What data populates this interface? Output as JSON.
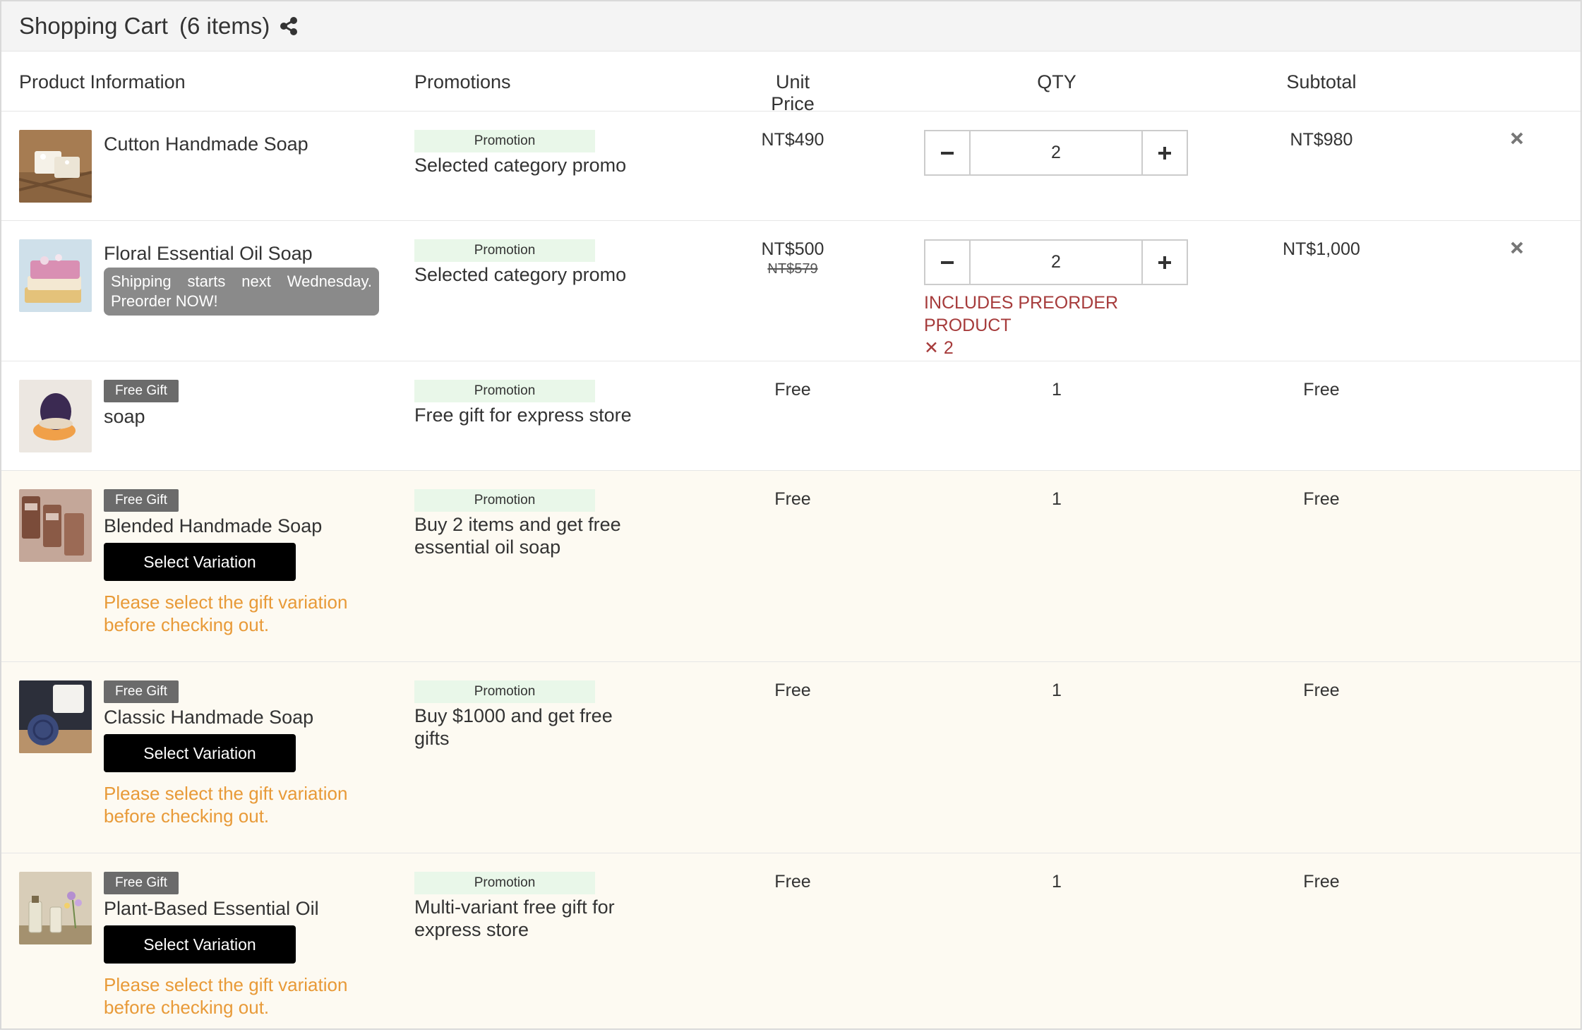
{
  "header": {
    "title": "Shopping Cart",
    "count": "(6 items)"
  },
  "columns": {
    "product": "Product Information",
    "promotions": "Promotions",
    "unit_price": "Unit Price",
    "qty": "QTY",
    "subtotal": "Subtotal"
  },
  "items": [
    {
      "name": "Cutton Handmade Soap",
      "promo_tag": "Promotion",
      "promo_text": "Selected category promo",
      "price": "NT$490",
      "qty": "2",
      "subtotal": "NT$980"
    },
    {
      "name": "Floral Essential Oil Soap",
      "note": "Shipping starts next Wednesday. Preorder NOW!",
      "promo_tag": "Promotion",
      "promo_text": "Selected category promo",
      "price": "NT$500",
      "orig_price": "NT$579",
      "qty": "2",
      "warning_line1": "INCLUDES PREORDER PRODUCT",
      "warning_line2": "✕ 2",
      "subtotal": "NT$1,000"
    },
    {
      "tag": "Free Gift",
      "name": "soap",
      "promo_tag": "Promotion",
      "promo_text": "Free gift for express store",
      "price": "Free",
      "qty": "1",
      "subtotal": "Free"
    },
    {
      "tag": "Free Gift",
      "name": "Blended Handmade Soap",
      "button": "Select Variation",
      "warning": "Please select the gift variation before checking out.",
      "promo_tag": "Promotion",
      "promo_text": "Buy 2 items and get free essential oil soap",
      "price": "Free",
      "qty": "1",
      "subtotal": "Free"
    },
    {
      "tag": "Free Gift",
      "name": "Classic Handmade Soap",
      "button": "Select Variation",
      "warning": "Please select the gift variation before checking out.",
      "promo_tag": "Promotion",
      "promo_text": "Buy $1000 and get free gifts",
      "price": "Free",
      "qty": "1",
      "subtotal": "Free"
    },
    {
      "tag": "Free Gift",
      "name": "Plant-Based Essential Oil",
      "button": "Select Variation",
      "warning": "Please select the gift variation before checking out.",
      "promo_tag": "Promotion",
      "promo_text": "Multi-variant free gift for express store",
      "price": "Free",
      "qty": "1",
      "subtotal": "Free"
    }
  ],
  "icons": {
    "share": "share-icon",
    "remove": "close-icon",
    "minus": "minus-icon",
    "plus": "plus-icon"
  },
  "colors": {
    "header_bg": "#f4f4f4",
    "promo_tag_bg": "#e9f7e9",
    "free_gift_tag_bg": "#6b6b6b",
    "gift_row_bg": "#fdfaf2",
    "gift_warning": "#e89a38",
    "preorder_warning": "#a63b3b",
    "select_button_bg": "#000000"
  }
}
